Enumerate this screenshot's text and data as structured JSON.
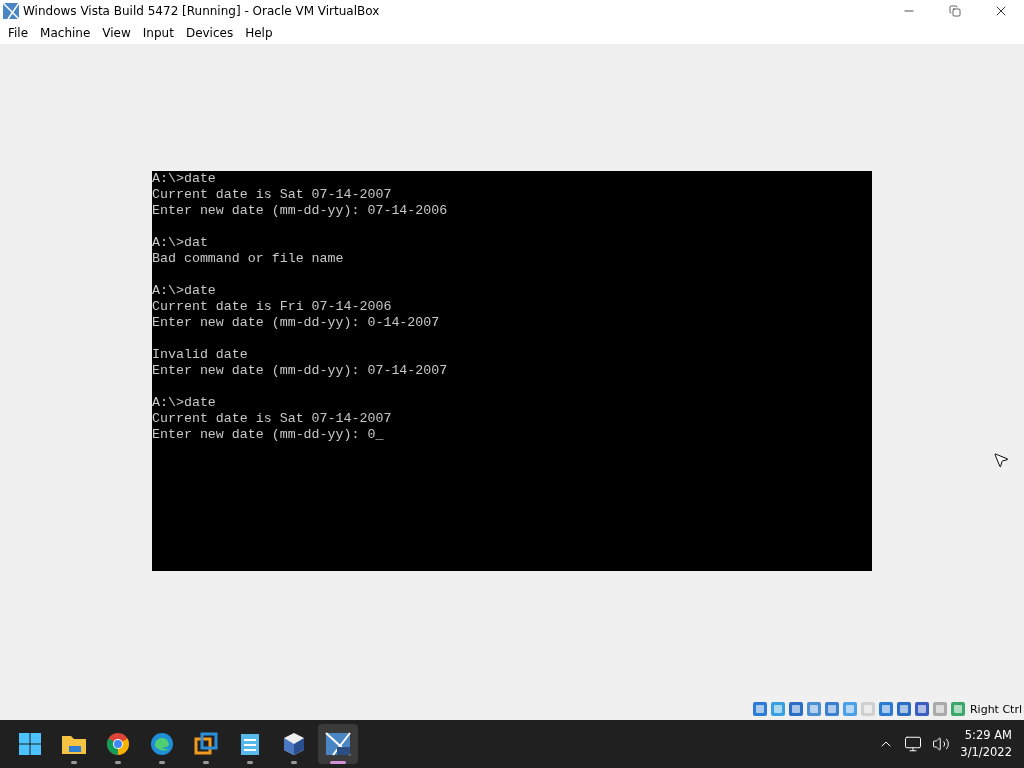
{
  "window": {
    "title": "Windows Vista Build 5472 [Running] - Oracle VM VirtualBox"
  },
  "menu": [
    "File",
    "Machine",
    "View",
    "Input",
    "Devices",
    "Help"
  ],
  "console": {
    "blocks": [
      {
        "lines": [
          "A:\\>date",
          "Current date is Sat 07-14-2007",
          "Enter new date (mm-dd-yy): 07-14-2006"
        ]
      },
      {
        "lines": [
          "A:\\>dat",
          "Bad command or file name"
        ]
      },
      {
        "lines": [
          "A:\\>date",
          "Current date is Fri 07-14-2006",
          "Enter new date (mm-dd-yy): 0-14-2007"
        ]
      },
      {
        "lines": [
          "Invalid date",
          "Enter new date (mm-dd-yy): 07-14-2007"
        ]
      },
      {
        "lines": [
          "A:\\>date",
          "Current date is Sat 07-14-2007",
          "Enter new date (mm-dd-yy): 0"
        ]
      }
    ],
    "cursor": "_"
  },
  "status_bar": {
    "host_key": "Right Ctrl"
  },
  "taskbar": {
    "apps": [
      {
        "kind": "start",
        "running": false,
        "selected": false
      },
      {
        "kind": "folder",
        "running": true,
        "selected": false
      },
      {
        "kind": "chrome",
        "running": true,
        "selected": false
      },
      {
        "kind": "edge",
        "running": true,
        "selected": false
      },
      {
        "kind": "vmware",
        "running": true,
        "selected": false
      },
      {
        "kind": "notepad",
        "running": true,
        "selected": false
      },
      {
        "kind": "virtualbox",
        "running": true,
        "selected": false
      },
      {
        "kind": "vista",
        "running": true,
        "selected": true
      }
    ],
    "time": "5:29 AM",
    "date": "3/1/2022"
  }
}
